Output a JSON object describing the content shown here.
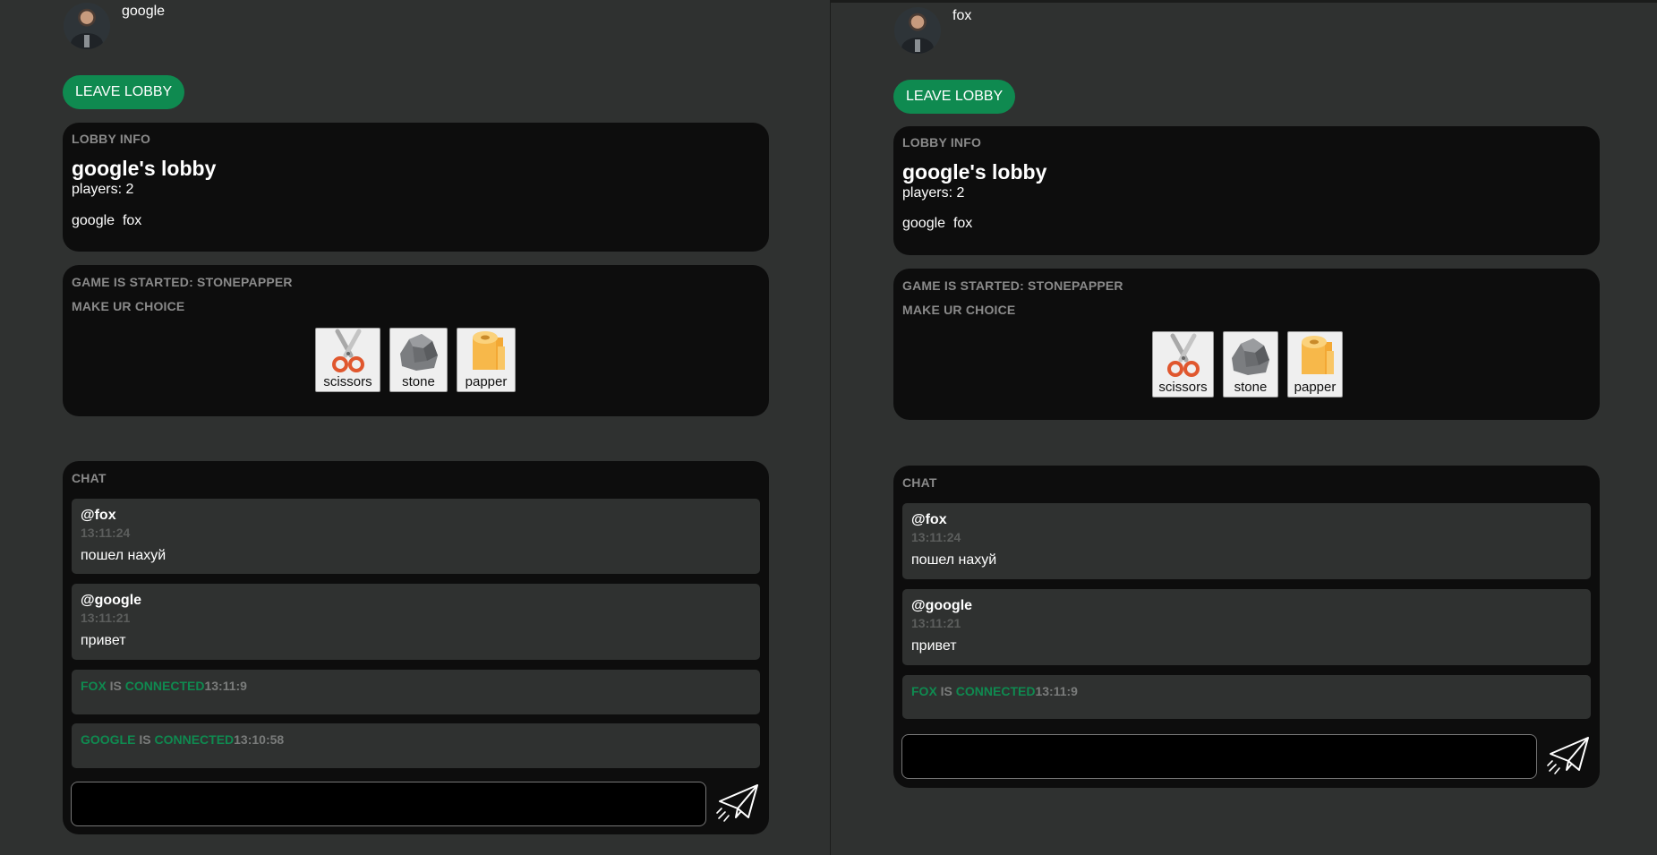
{
  "panes": [
    {
      "username": "google",
      "leave_label": "LEAVE LOBBY",
      "lobby": {
        "section_title": "LOBBY INFO",
        "name": "google's lobby",
        "players_count": "players: 2",
        "players": "google  fox"
      },
      "game": {
        "status": "GAME IS STARTED: STONEPAPPER",
        "prompt": "MAKE UR CHOICE",
        "choices": [
          {
            "label": "scissors",
            "icon": "scissors-icon"
          },
          {
            "label": "stone",
            "icon": "stone-icon"
          },
          {
            "label": "papper",
            "icon": "paper-roll-icon"
          }
        ]
      },
      "chat": {
        "title": "CHAT",
        "messages": [
          {
            "author": "@fox",
            "time": "13:11:24",
            "text": "пошел нахуй"
          },
          {
            "author": "@google",
            "time": "13:11:21",
            "text": "привет"
          }
        ],
        "system": [
          {
            "name": "FOX",
            "is": " IS ",
            "status": "CONNECTED",
            "time": "13:11:9"
          },
          {
            "name": "GOOGLE",
            "is": " IS ",
            "status": "CONNECTED",
            "time": "13:10:58"
          }
        ],
        "input_value": "",
        "send_icon": "paper-plane-icon"
      }
    },
    {
      "username": "fox",
      "leave_label": "LEAVE LOBBY",
      "lobby": {
        "section_title": "LOBBY INFO",
        "name": "google's lobby",
        "players_count": "players: 2",
        "players": "google  fox"
      },
      "game": {
        "status": "GAME IS STARTED: STONEPAPPER",
        "prompt": "MAKE UR CHOICE",
        "choices": [
          {
            "label": "scissors",
            "icon": "scissors-icon"
          },
          {
            "label": "stone",
            "icon": "stone-icon"
          },
          {
            "label": "papper",
            "icon": "paper-roll-icon"
          }
        ]
      },
      "chat": {
        "title": "CHAT",
        "messages": [
          {
            "author": "@fox",
            "time": "13:11:24",
            "text": "пошел нахуй"
          },
          {
            "author": "@google",
            "time": "13:11:21",
            "text": "привет"
          }
        ],
        "system": [
          {
            "name": "FOX",
            "is": " IS ",
            "status": "CONNECTED",
            "time": "13:11:9"
          }
        ],
        "input_value": "",
        "send_icon": "paper-plane-icon"
      }
    }
  ],
  "colors": {
    "background": "#2f3130",
    "panel": "#0d0d0d",
    "accent_green": "#0f8a50",
    "muted_text": "#8a8a8a"
  }
}
